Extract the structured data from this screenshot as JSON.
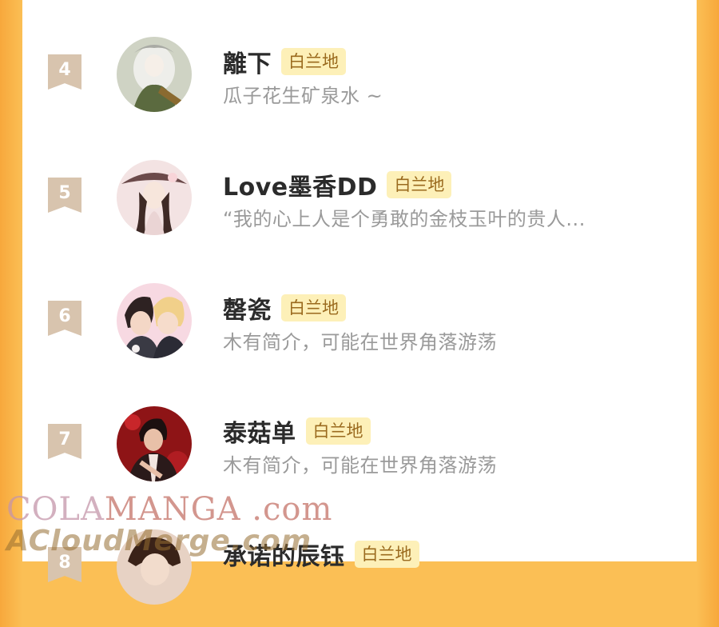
{
  "rows": [
    {
      "rank": "4",
      "name": "離下",
      "badge": "白兰地",
      "intro": "瓜子花生矿泉水 ~"
    },
    {
      "rank": "5",
      "name": "Love墨香DD",
      "badge": "白兰地",
      "intro": "“我的心上人是个勇敢的金枝玉叶的贵人..."
    },
    {
      "rank": "6",
      "name": "罄瓷",
      "badge": "白兰地",
      "intro": "木有简介，可能在世界角落游荡"
    },
    {
      "rank": "7",
      "name": "泰菇单",
      "badge": "白兰地",
      "intro": "木有简介，可能在世界角落游荡"
    },
    {
      "rank": "8",
      "name": "承诺的辰钰",
      "badge": "白兰地",
      "intro": ""
    }
  ],
  "watermark": {
    "line1_lead": "COLA",
    "line1_rest": "MANGA  .com",
    "line2": "ACloudMerge.com"
  },
  "colors": {
    "accent": "#fbbf55",
    "badge_bg": "#fdf0b8",
    "rank_bg": "#d8c4ae"
  }
}
